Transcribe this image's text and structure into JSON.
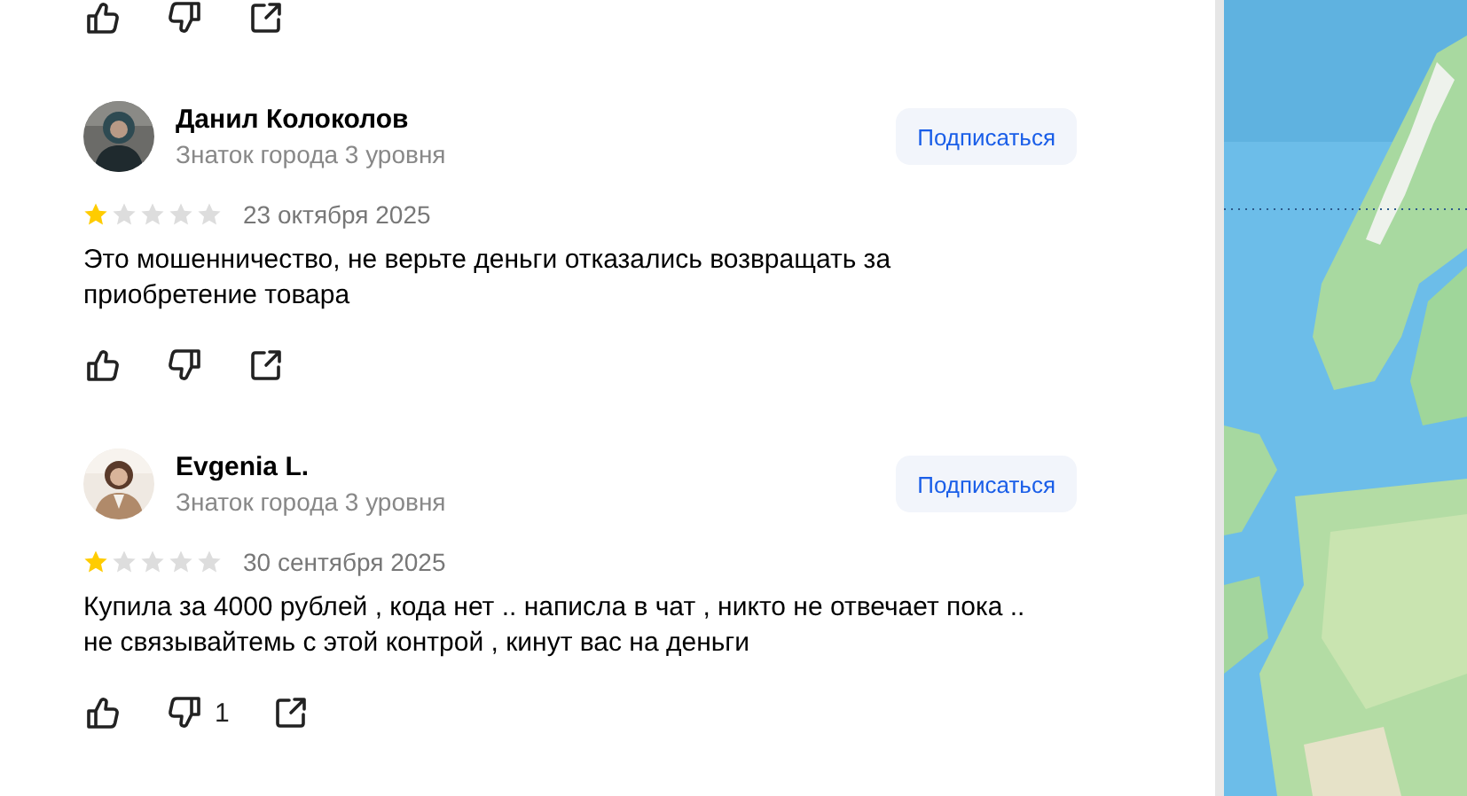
{
  "reviews": [
    {
      "name": "Данил Колоколов",
      "badge": "Знаток города 3 уровня",
      "subscribe": "Подписаться",
      "stars": 1,
      "date": "23 октября 2025",
      "text": "Это мошенничество, не верьте деньги отказались возвращать за приобретение товара"
    },
    {
      "name": "Evgenia L.",
      "badge": "Знаток города 3 уровня",
      "subscribe": "Подписаться",
      "stars": 1,
      "date": "30 сентября 2025",
      "text": "Купила за 4000 рублей , кода нет .. написла в чат , никто не отвечает пока .. не связывайтемь с этой контрой , кинут вас на деньги",
      "dislike_count": "1"
    }
  ]
}
